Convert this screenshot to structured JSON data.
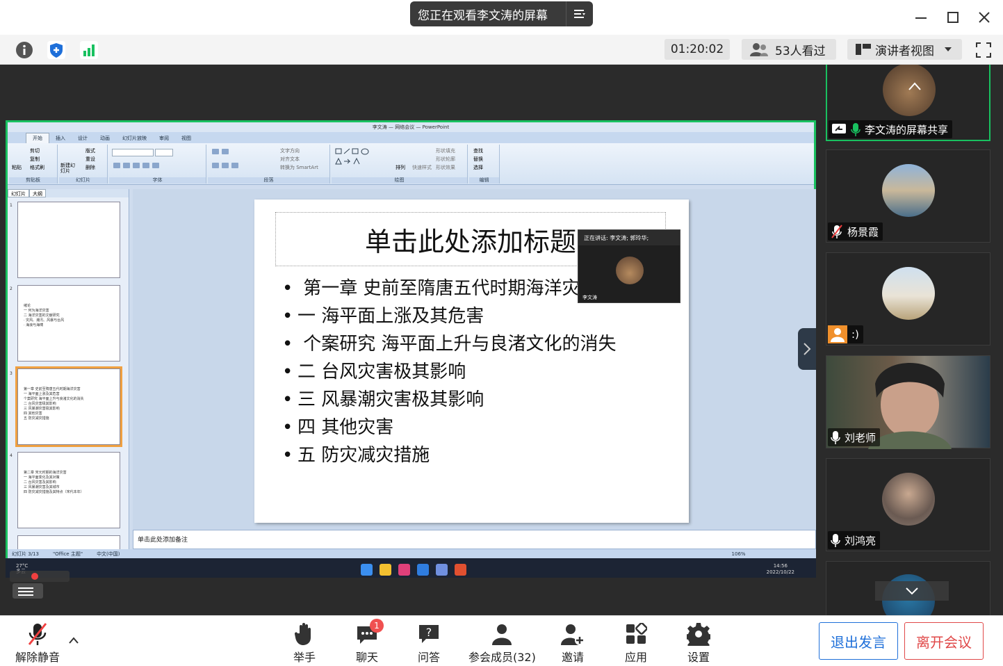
{
  "window": {
    "sharing_banner": "您正在观看李文涛的屏幕",
    "minimize_label": "—",
    "maximize_label": "☐",
    "close_label": "✕"
  },
  "toolbar": {
    "timer": "01:20:02",
    "viewers": "53人看过",
    "view_mode": "演讲者视图"
  },
  "ppt": {
    "window_title": "李文涛 — 网络会议 — PowerPoint",
    "ribbon_tabs": [
      "开始",
      "插入",
      "设计",
      "动画",
      "幻灯片放映",
      "审阅",
      "视图"
    ],
    "ribbon_groups": [
      "剪贴板",
      "幻灯片",
      "字体",
      "段落",
      "绘图",
      "编辑"
    ],
    "ribbon_buttons": [
      "剪切",
      "复制",
      "格式刷",
      "粘贴",
      "新建幻灯片",
      "版式",
      "重设",
      "删除",
      "文字方向",
      "对齐文本",
      "转换为 SmartArt",
      "排列",
      "快速样式",
      "形状填充",
      "形状轮廓",
      "形状效果",
      "查找",
      "替换",
      "选择"
    ],
    "panel_tabs": [
      "幻灯片",
      "大纲"
    ],
    "thumbnails": [
      {
        "num": "1",
        "lines": []
      },
      {
        "num": "2",
        "lines": [
          "绪论",
          "一 何为海洋灾害",
          "二 海洋灾害的文献研究",
          "· 灾风、潮汛、风暴与台风",
          "· 海浪与海啸"
        ]
      },
      {
        "num": "3",
        "lines": [
          "第一章 史前至隋唐五代时期海洋灾害",
          "一 海平面上涨及其危害",
          "个案研究 海平面上升与良渚文化的消失",
          "二 台风灾害极其影响",
          "三 风暴潮灾害极其影响",
          "四 其他灾害",
          "五 防灾减灾措施"
        ]
      },
      {
        "num": "4",
        "lines": [
          "第二章 宋元时期的海洋灾害",
          "一 海平面变化及其对策",
          "二 台风灾害及其影响",
          "三 风暴潮灾害及其城市",
          "四 防灾减灾措施及其特点（宋代本年）"
        ]
      }
    ],
    "slide_title": "单击此处添加标题",
    "slide_bullets": [
      "  第一章  史前至隋唐五代时期海洋灾害",
      "一 海平面上涨及其危害",
      "  个案研究  海平面上升与良渚文化的消失",
      "二 台风灾害极其影响",
      "三 风暴潮灾害极其影响",
      "四 其他灾害",
      "五 防灾减灾措施"
    ],
    "notes_placeholder": "单击此处添加备注",
    "status_slide": "幻灯片 3/13",
    "status_theme": "\"Office 主题\"",
    "status_lang": "中文(中国)",
    "zoom": "106%"
  },
  "speaker_mini": {
    "header": "正在讲话: 李文涛; 郭玲华;",
    "name": "李文涛"
  },
  "taskbar": {
    "weather_temp": "27°C",
    "weather_desc": "多云",
    "time": "14:56",
    "date": "2022/10/22"
  },
  "participants": [
    {
      "name": "李文涛的屏幕共享",
      "mic": "on",
      "sharing": true
    },
    {
      "name": "杨景霞",
      "mic": "muted"
    },
    {
      "name": ":)",
      "mic": "none"
    },
    {
      "name": "刘老师",
      "mic": "on"
    },
    {
      "name": "刘鸿亮",
      "mic": "on"
    }
  ],
  "bottom": {
    "unmute": "解除静音",
    "raise_hand": "举手",
    "chat": "聊天",
    "chat_badge": "1",
    "qa": "问答",
    "members": "参会成员(32)",
    "invite": "邀请",
    "apps": "应用",
    "settings": "设置",
    "exit_speaking": "退出发言",
    "leave": "离开会议"
  },
  "colors": {
    "accent_green": "#19c160",
    "leave_red": "#e04848",
    "primary_blue": "#1e6fd9"
  }
}
